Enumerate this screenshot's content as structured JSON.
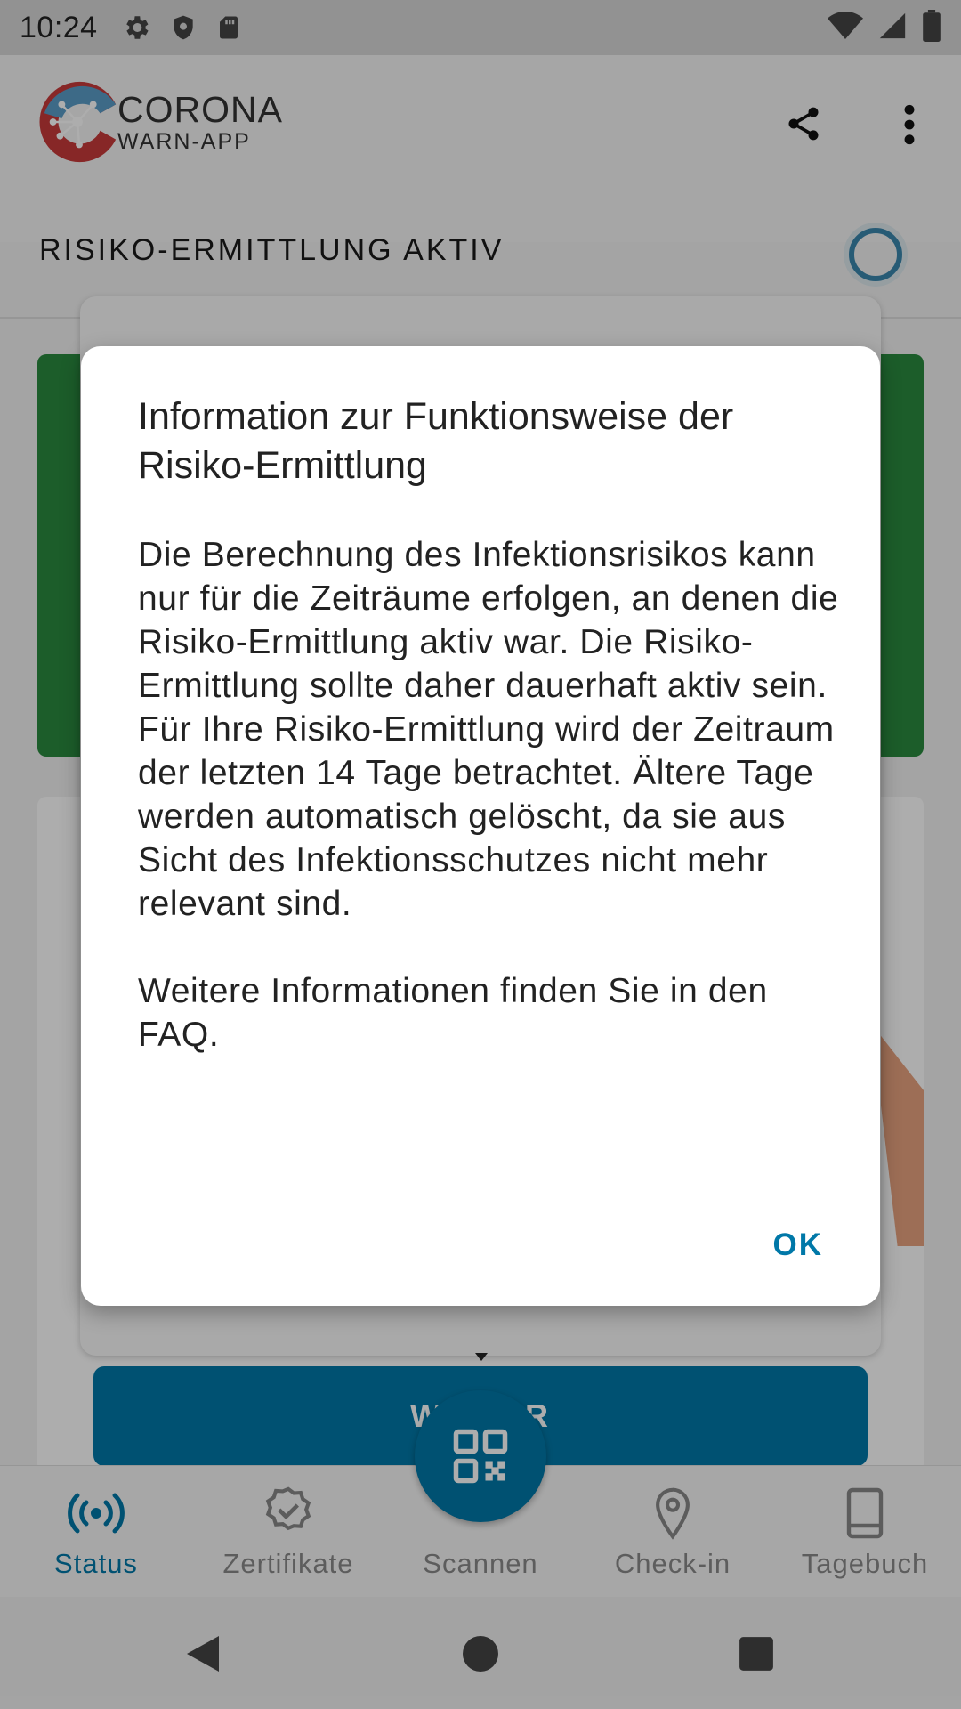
{
  "status_bar": {
    "time": "10:24",
    "icons": [
      "settings-icon",
      "shield-icon",
      "sd-card-icon",
      "wifi-icon",
      "signal-icon",
      "battery-icon"
    ]
  },
  "app_bar": {
    "logo_title": "CORONA",
    "logo_subtitle": "WARN-APP",
    "actions": [
      "share-icon",
      "more-vertical-icon"
    ]
  },
  "risk_header": {
    "title": "RISIKO-ERMITTLUNG AKTIV"
  },
  "background": {
    "button_label": "WEITER"
  },
  "bottom_nav": {
    "items": [
      {
        "label": "Status",
        "icon": "broadcast-icon",
        "active": true
      },
      {
        "label": "Zertifikate",
        "icon": "certificate-check-icon",
        "active": false
      },
      {
        "label": "Scannen",
        "icon": "qr-code-icon",
        "active": false
      },
      {
        "label": "Check-in",
        "icon": "location-pin-icon",
        "active": false
      },
      {
        "label": "Tagebuch",
        "icon": "book-icon",
        "active": false
      }
    ]
  },
  "dialog": {
    "title": "Information zur Funktionsweise der Risiko-Ermittlung",
    "paragraph1": "Die Berechnung des Infektionsrisikos kann nur für die Zeiträume erfolgen, an denen die Risiko-Ermittlung aktiv war. Die Risiko- Ermittlung sollte daher dauerhaft aktiv sein. Für Ihre Risiko-Ermittlung wird der Zeitraum der letzten 14 Tage betrachtet. Ältere Tage werden automatisch gelöscht, da sie aus Sicht des Infektionsschutzes nicht mehr relevant sind.",
    "paragraph2": "Weitere Informationen finden Sie in den FAQ.",
    "ok_label": "OK"
  },
  "colors": {
    "accent": "#0078a8",
    "status_green": "#2a8a3f",
    "scrim": "rgba(0,0,0,0.32)"
  }
}
